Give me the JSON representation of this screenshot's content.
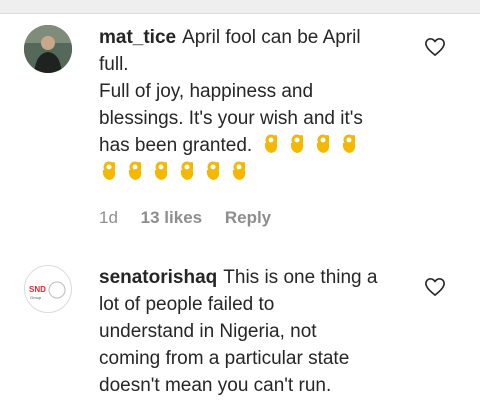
{
  "comments": [
    {
      "username": "mat_tice",
      "lines": [
        "April fool can be April",
        "full.",
        "Full of joy, happiness and",
        "blessings. It's your wish and it's",
        "has been granted."
      ],
      "emoji_icon": "ok-hand-icon",
      "emoji_count_line1": 4,
      "emoji_count_line2": 6,
      "time": "1d",
      "likes": "13 likes",
      "reply": "Reply"
    },
    {
      "username": "senatorishaq",
      "lines": [
        "This is one thing a",
        "lot of people failed to",
        "understand in Nigeria, not",
        "coming from a particular state",
        "doesn't mean you can't run."
      ],
      "avatar_logo": "SND",
      "avatar_logo_sub": "Group"
    }
  ],
  "colors": {
    "text": "#262626",
    "meta": "#8e8e8e",
    "emoji": "#f5b800"
  }
}
